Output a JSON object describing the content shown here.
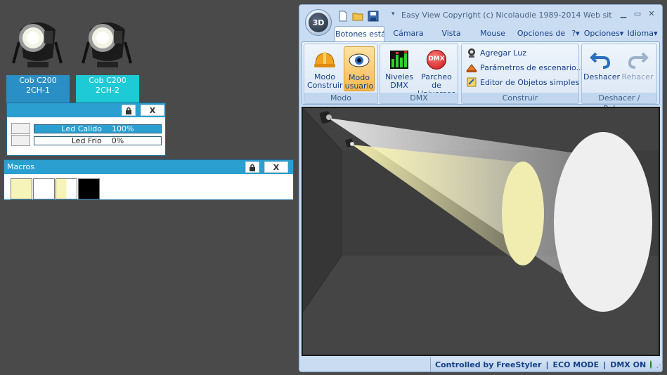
{
  "fixtures": [
    {
      "line1": "Cob C200",
      "line2": "2CH-1",
      "color": "#2a8fc4"
    },
    {
      "line1": "Cob C200",
      "line2": "2CH-2",
      "color": "#1ecad6"
    }
  ],
  "faders_panel": {
    "lock_icon": "lock-icon",
    "close_label": "X",
    "faders": [
      {
        "name": "Led Calido",
        "value_label": "100%",
        "level": 1.0
      },
      {
        "name": "Led Frio",
        "value_label": "0%",
        "level": 0.0
      }
    ]
  },
  "macros_panel": {
    "title": "Macros",
    "close_label": "X",
    "swatches": [
      "#f6f4b8",
      "#ffffff",
      "#f6f4b8+#ffffff",
      "#000000"
    ]
  },
  "window": {
    "orb_label": "3D",
    "title": "Easy View   Copyright (c) Nicolaudie 1989-2014   Web sit...",
    "tabs": [
      "Botones está",
      "Cámara",
      "Vista",
      "Mouse",
      "Opciones de"
    ],
    "right_menus": [
      "?",
      "Opciones",
      "Idioma"
    ],
    "groups": {
      "modo": {
        "label": "Modo",
        "construir": [
          "Modo",
          "Construir"
        ],
        "usuario": [
          "Modo",
          "usuario"
        ]
      },
      "dmx": {
        "label": "DMX",
        "niveles": [
          "Niveles",
          "DMX"
        ],
        "parcheo": [
          "Parcheo de",
          "Universos"
        ],
        "dmx_badge": "DMX"
      },
      "construir": {
        "label": "Construir",
        "items": [
          "Agregar Luz",
          "Parámetros de escenario...",
          "Editor de Objetos simples"
        ]
      },
      "deshacer": {
        "label": "Deshacer / Rehacer",
        "undo": "Deshacer",
        "redo": "Rehacer"
      }
    },
    "status": {
      "controlled": "Controlled by FreeStyler",
      "sep": "|",
      "eco": "ECO MODE",
      "dmx": "DMX ON"
    }
  },
  "colors": {
    "panel_header": "#2a9fd0",
    "beam_warm": "#f1ecb0",
    "beam_cold": "#efefef",
    "accent_orange": "#f9b84e"
  }
}
